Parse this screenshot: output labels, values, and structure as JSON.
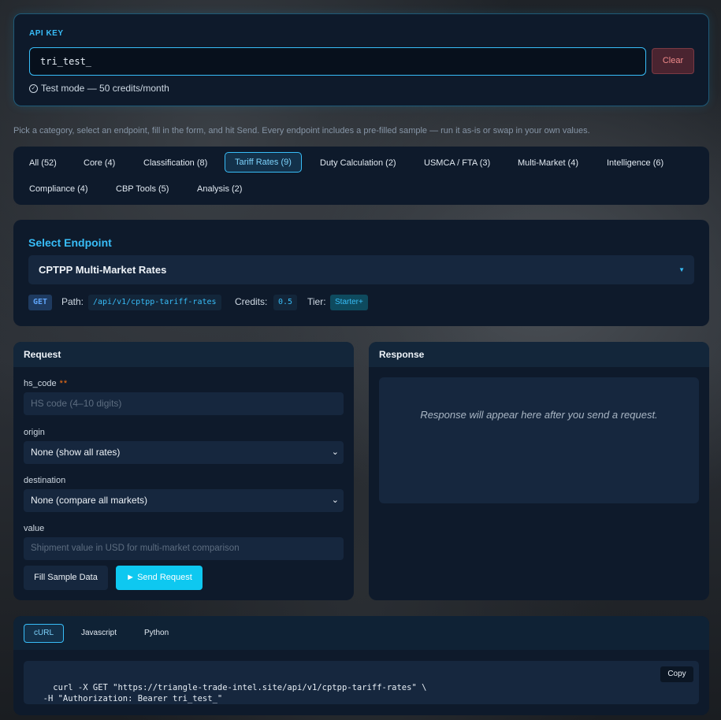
{
  "api_key": {
    "label": "API KEY",
    "value": "tri_test_",
    "clear_label": "Clear",
    "mode_text": "Test mode — 50 credits/month"
  },
  "intro_text": "Pick a category, select an endpoint, fill in the form, and hit Send. Every endpoint includes a pre-filled sample — run it as-is or swap in your own values.",
  "categories": [
    {
      "label": "All (52)"
    },
    {
      "label": "Core (4)"
    },
    {
      "label": "Classification (8)"
    },
    {
      "label": "Tariff Rates (9)",
      "active": true
    },
    {
      "label": "Duty Calculation (2)"
    },
    {
      "label": "USMCA / FTA (3)"
    },
    {
      "label": "Multi-Market (4)"
    },
    {
      "label": "Intelligence (6)"
    },
    {
      "label": "Compliance (4)"
    },
    {
      "label": "CBP Tools (5)"
    },
    {
      "label": "Analysis (2)"
    }
  ],
  "endpoint": {
    "section_title": "Select Endpoint",
    "selected": "CPTPP Multi-Market Rates",
    "method": "GET",
    "path_label": "Path:",
    "path": "/api/v1/cptpp-tariff-rates",
    "credits_label": "Credits:",
    "credits": "0.5",
    "tier_label": "Tier:",
    "tier": "Starter+"
  },
  "request": {
    "title": "Request",
    "fields": [
      {
        "label": "hs_code",
        "required_mark": "**",
        "placeholder": "HS code (4–10 digits)"
      },
      {
        "label": "origin",
        "value": "None (show all rates)"
      },
      {
        "label": "destination",
        "value": "None (compare all markets)"
      },
      {
        "label": "value",
        "placeholder": "Shipment value in USD for multi-market comparison"
      }
    ],
    "fill_sample_label": "Fill Sample Data",
    "send_label": "► Send Request"
  },
  "response": {
    "title": "Response",
    "empty_text": "Response will appear here after you send a request."
  },
  "code": {
    "tabs": [
      "cURL",
      "Javascript",
      "Python"
    ],
    "active_tab": "cURL",
    "snippet": "curl -X GET \"https://triangle-trade-intel.site/api/v1/cptpp-tariff-rates\" \\\n  -H \"Authorization: Bearer tri_test_\"",
    "copy_label": "Copy"
  },
  "colors": {
    "accent": "#38bdf8",
    "card_bg": "#0e1a2b",
    "send_button": "#0ec8f0",
    "clear_button": "#4a2430"
  }
}
